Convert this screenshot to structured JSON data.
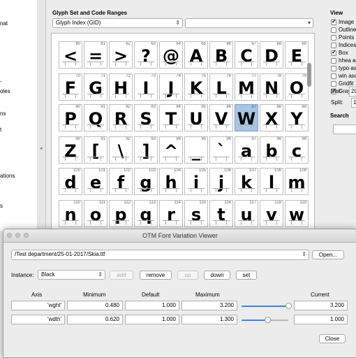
{
  "left_panel": {
    "items": [
      "nat",
      "-",
      "oles",
      "ns",
      "t",
      "ations",
      "s"
    ]
  },
  "glyph_panel": {
    "header": "Glyph Set and Code Ranges",
    "mode_select": "Glyph Index (GID)",
    "range_select": "",
    "glyphs": [
      {
        "num": "60",
        "ch": "<"
      },
      {
        "num": "61",
        "ch": "="
      },
      {
        "num": "62",
        "ch": ">"
      },
      {
        "num": "63",
        "ch": "?"
      },
      {
        "num": "64",
        "ch": "@"
      },
      {
        "num": "65",
        "ch": "A"
      },
      {
        "num": "66",
        "ch": "B"
      },
      {
        "num": "67",
        "ch": "C"
      },
      {
        "num": "68",
        "ch": "D"
      },
      {
        "num": "69",
        "ch": "E"
      },
      {
        "num": "70",
        "ch": "F"
      },
      {
        "num": "71",
        "ch": "G"
      },
      {
        "num": "72",
        "ch": "H"
      },
      {
        "num": "73",
        "ch": "I"
      },
      {
        "num": "74",
        "ch": "J"
      },
      {
        "num": "75",
        "ch": "K"
      },
      {
        "num": "76",
        "ch": "L"
      },
      {
        "num": "77",
        "ch": "M"
      },
      {
        "num": "78",
        "ch": "N"
      },
      {
        "num": "79",
        "ch": "O"
      },
      {
        "num": "80",
        "ch": "P"
      },
      {
        "num": "81",
        "ch": "Q"
      },
      {
        "num": "82",
        "ch": "R"
      },
      {
        "num": "83",
        "ch": "S"
      },
      {
        "num": "84",
        "ch": "T"
      },
      {
        "num": "85",
        "ch": "U"
      },
      {
        "num": "86",
        "ch": "V"
      },
      {
        "num": "87",
        "ch": "W"
      },
      {
        "num": "88",
        "ch": "X"
      },
      {
        "num": "89",
        "ch": "Y"
      },
      {
        "num": "90",
        "ch": "Z"
      },
      {
        "num": "91",
        "ch": "["
      },
      {
        "num": "92",
        "ch": "\\"
      },
      {
        "num": "93",
        "ch": "]"
      },
      {
        "num": "94",
        "ch": "^"
      },
      {
        "num": "95",
        "ch": "_"
      },
      {
        "num": "96",
        "ch": "`"
      },
      {
        "num": "97",
        "ch": "a"
      },
      {
        "num": "98",
        "ch": "b"
      },
      {
        "num": "99",
        "ch": "c"
      },
      {
        "num": "100",
        "ch": "d"
      },
      {
        "num": "101",
        "ch": "e"
      },
      {
        "num": "102",
        "ch": "f"
      },
      {
        "num": "103",
        "ch": "g"
      },
      {
        "num": "104",
        "ch": "h"
      },
      {
        "num": "105",
        "ch": "i"
      },
      {
        "num": "106",
        "ch": "j"
      },
      {
        "num": "107",
        "ch": "k"
      },
      {
        "num": "108",
        "ch": "l"
      },
      {
        "num": "109",
        "ch": "m"
      },
      {
        "num": "110",
        "ch": "n"
      },
      {
        "num": "111",
        "ch": "o"
      },
      {
        "num": "112",
        "ch": "p"
      },
      {
        "num": "113",
        "ch": "q"
      },
      {
        "num": "114",
        "ch": "r"
      },
      {
        "num": "115",
        "ch": "s"
      },
      {
        "num": "116",
        "ch": "t"
      },
      {
        "num": "117",
        "ch": "u"
      },
      {
        "num": "118",
        "ch": "v"
      },
      {
        "num": "119",
        "ch": "w"
      }
    ],
    "selected_glyph": "87"
  },
  "view_panel": {
    "header": "View",
    "options": [
      {
        "label": "Image",
        "checked": true
      },
      {
        "label": "Outline",
        "checked": false
      },
      {
        "label": "Points",
        "checked": false
      },
      {
        "label": "Indices",
        "checked": false
      },
      {
        "label": "Box",
        "checked": true
      },
      {
        "label": "hhea a",
        "checked": false
      },
      {
        "label": "typo as",
        "checked": false
      },
      {
        "label": "win asc",
        "checked": false
      },
      {
        "label": "Gridfit",
        "checked": false
      },
      {
        "label": "Graysc",
        "checked": true
      }
    ],
    "dist_label": "Dist:",
    "dist_value": "20",
    "split_label": "Split:",
    "split_value": "1",
    "search_label": "Search",
    "search_value": ""
  },
  "dialog": {
    "title": "OTM Font Variation Viewer",
    "file_path": "/Test department/25-01-2017/Skia.ttf",
    "open_button": "Open...",
    "instance_label": "Instance:",
    "instance_value": "Black",
    "add_button": "add",
    "remove_button": "remove",
    "up_button": "up",
    "down_button": "down",
    "set_button": "set",
    "columns": {
      "axis": "Axis",
      "minimum": "Minimum",
      "default": "Default",
      "maximum": "Maximum",
      "current": "Current"
    },
    "axes": [
      {
        "tag": "'wght'",
        "minimum": "0.480",
        "default": "1.000",
        "maximum": "3.200",
        "current": "3.200",
        "slider_fraction": 1.0
      },
      {
        "tag": "'wdth'",
        "minimum": "0.620",
        "default": "1.000",
        "maximum": "1.300",
        "current": "1.000",
        "slider_fraction": 0.56
      }
    ],
    "close_button": "Close",
    "accent_color": "#3b82f0"
  }
}
